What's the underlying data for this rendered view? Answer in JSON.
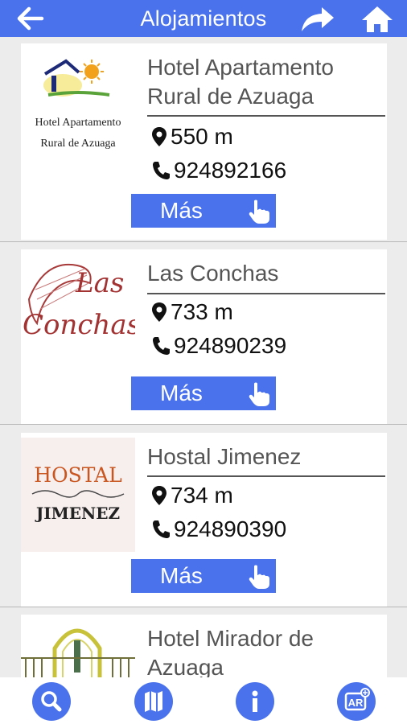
{
  "header": {
    "title": "Alojamientos"
  },
  "colors": {
    "accent": "#4a72ec",
    "text_name": "#555555"
  },
  "icons": {
    "back": "arrow-left-icon",
    "share": "share-icon",
    "home": "home-icon",
    "distance": "location-pin-icon",
    "phone": "phone-icon",
    "hand": "hand-pointer-icon",
    "search": "search-icon",
    "map": "map-icon",
    "info": "info-icon",
    "ar": "ar-icon"
  },
  "items": [
    {
      "name_line1": "Hotel Apartamento",
      "name_line2": "Rural de Azuaga",
      "distance": "550 m",
      "phone": "924892166",
      "more": "Más",
      "logo_line1": "Hotel Apartamento",
      "logo_line2": "Rural de Azuaga"
    },
    {
      "name_line1": "Las Conchas",
      "name_line2": "",
      "distance": "733 m",
      "phone": "924890239",
      "more": "Más",
      "logo_line1": "Las",
      "logo_line2": "Conchas"
    },
    {
      "name_line1": "Hostal Jimenez",
      "name_line2": "",
      "distance": "734 m",
      "phone": "924890390",
      "more": "Más",
      "logo_line1": "HOSTAL",
      "logo_line2": "JIMENEZ"
    },
    {
      "name_line1": "Hotel Mirador de",
      "name_line2": "Azuaga"
    }
  ]
}
